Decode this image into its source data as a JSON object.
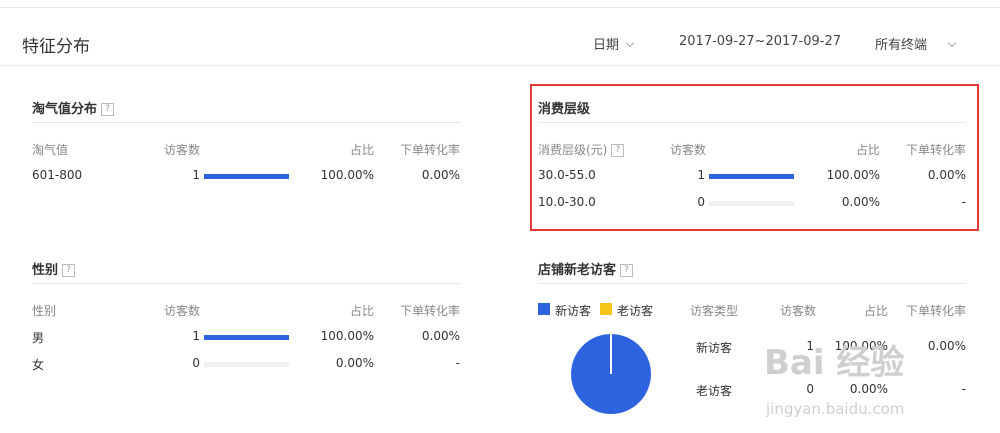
{
  "header": {
    "title": "特征分布",
    "date_label": "日期",
    "date_range": "2017-09-27~2017-09-27",
    "terminal": "所有终端"
  },
  "taoqi": {
    "title": "淘气值分布",
    "help": "?",
    "columns": [
      "淘气值",
      "访客数",
      "占比",
      "下单转化率"
    ],
    "rows": [
      {
        "label": "601-800",
        "visitors": "1",
        "ratio": "100.00%",
        "conversion": "0.00%",
        "bar_fraction": 1.0
      }
    ]
  },
  "spending": {
    "title": "消费层级",
    "help": "?",
    "columns": [
      "消费层级(元)",
      "访客数",
      "占比",
      "下单转化率"
    ],
    "rows": [
      {
        "label": "30.0-55.0",
        "visitors": "1",
        "ratio": "100.00%",
        "conversion": "0.00%",
        "bar_fraction": 1.0
      },
      {
        "label": "10.0-30.0",
        "visitors": "0",
        "ratio": "0.00%",
        "conversion": "-",
        "bar_fraction": 0.0
      }
    ]
  },
  "gender": {
    "title": "性别",
    "help": "?",
    "columns": [
      "性别",
      "访客数",
      "占比",
      "下单转化率"
    ],
    "rows": [
      {
        "label": "男",
        "visitors": "1",
        "ratio": "100.00%",
        "conversion": "0.00%",
        "bar_fraction": 1.0
      },
      {
        "label": "女",
        "visitors": "0",
        "ratio": "0.00%",
        "conversion": "-",
        "bar_fraction": 0.0
      }
    ]
  },
  "visitors": {
    "title": "店铺新老访客",
    "help": "?",
    "legend": [
      {
        "label": "新访客",
        "color": "#2e63e0"
      },
      {
        "label": "老访客",
        "color": "#f5c518"
      }
    ],
    "columns": [
      "访客类型",
      "访客数",
      "占比",
      "下单转化率"
    ],
    "rows": [
      {
        "label": "新访客",
        "visitors": "1",
        "ratio": "100.00%",
        "conversion": "0.00%"
      },
      {
        "label": "老访客",
        "visitors": "0",
        "ratio": "0.00%",
        "conversion": "-"
      }
    ],
    "pie_new_fraction": 1.0
  },
  "watermark": {
    "brand": "Bai 经验",
    "url": "jingyan.baidu.com"
  },
  "colors": {
    "accent": "#2e63e0",
    "highlight": "#e53935"
  }
}
